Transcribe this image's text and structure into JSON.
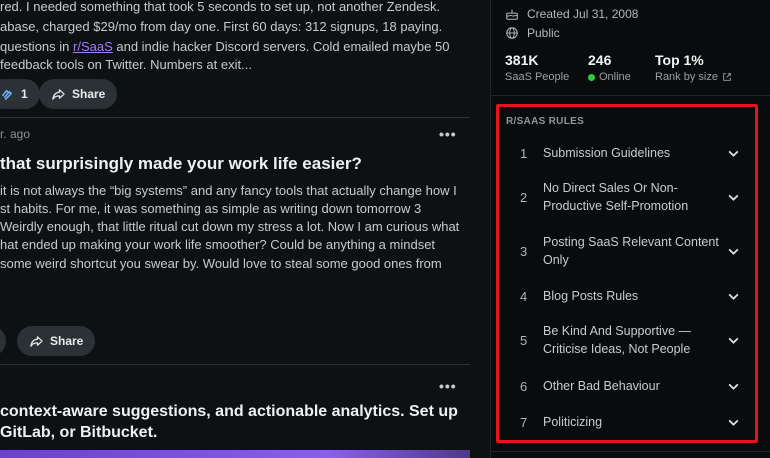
{
  "feed": {
    "post1": {
      "lines": [
        "red. I needed something that took 5 seconds to set up, not another Zendesk.",
        "abase, charged $29/mo from day one. First 60 days: 312 signups, 18 paying.",
        "questions in ",
        "feedback tools on Twitter. Numbers at exit..."
      ],
      "line3_link": "r/SaaS",
      "line3_rest": " and indie hacker Discord servers. Cold emailed maybe 50",
      "vote_count": "1",
      "share_label": "Share"
    },
    "post2": {
      "time": "r. ago",
      "more": "•••",
      "title": "that surprisingly made your work life easier?",
      "lines": [
        "it is not always the “big systems” and any fancy tools that actually change how I",
        "st habits. For me, it was something as simple as writing down tomorrow 3",
        "Weirdly enough, that little ritual cut down my stress a lot. Now I am curious what",
        "hat ended up making your work life smoother? Could be anything a mindset",
        "some weird shortcut you swear by. Would love to steal some good ones from"
      ],
      "share_label": "Share"
    },
    "post3": {
      "more": "•••",
      "title_lines": [
        "context-aware suggestions, and actionable analytics. Set up",
        "GitLab, or Bitbucket."
      ]
    }
  },
  "sidebar": {
    "created": "Created Jul 31, 2008",
    "visibility": "Public",
    "stats": [
      {
        "value": "381K",
        "label": "SaaS People"
      },
      {
        "value": "246",
        "label": "Online"
      },
      {
        "value": "Top 1%",
        "label": "Rank by size"
      }
    ],
    "rules_heading": "R/SAAS RULES",
    "rules": [
      {
        "num": "1",
        "label": "Submission Guidelines"
      },
      {
        "num": "2",
        "label": "No Direct Sales Or Non-Productive Self-Promotion"
      },
      {
        "num": "3",
        "label": "Posting SaaS Relevant Content Only"
      },
      {
        "num": "4",
        "label": "Blog Posts Rules"
      },
      {
        "num": "5",
        "label": "Be Kind And Supportive — Criticise Ideas, Not People"
      },
      {
        "num": "6",
        "label": "Other Bad Behaviour"
      },
      {
        "num": "7",
        "label": "Politicizing"
      }
    ]
  },
  "colors": {
    "highlight_border": "#e3141b",
    "link": "#a27cff",
    "online": "#2ecc40"
  }
}
